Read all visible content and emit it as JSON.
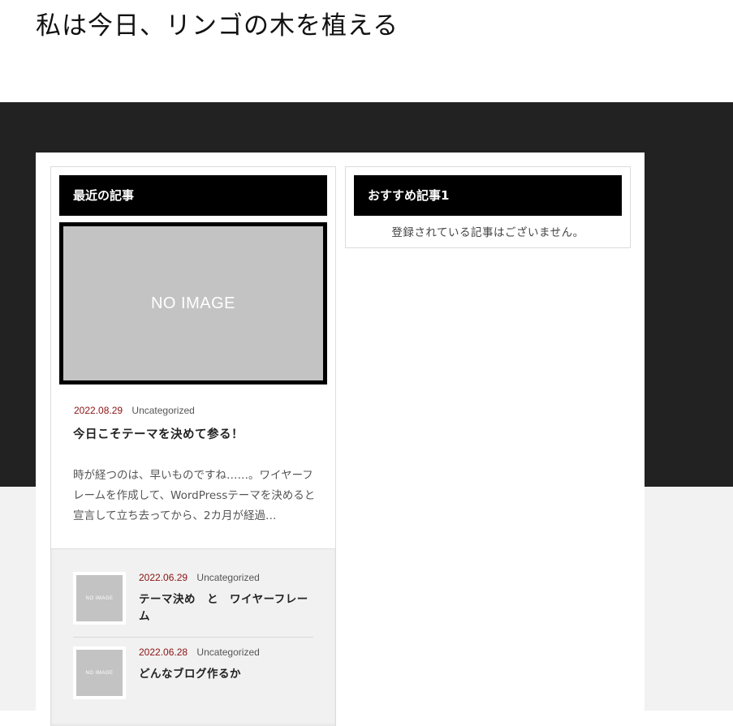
{
  "site": {
    "title": "私は今日、リンゴの木を植える"
  },
  "recent_widget": {
    "heading": "最近の記事",
    "featured": {
      "image_label": "NO IMAGE",
      "date": "2022.08.29",
      "category": "Uncategorized",
      "title": "今日こそテーマを決めて参る！",
      "excerpt": "時が経つのは、早いものですね……。ワイヤーフレームを作成して、WordPressテーマを決めると宣言して立ち去ってから、2カ月が経過…"
    },
    "items": [
      {
        "image_label": "NO IMAGE",
        "date": "2022.06.29",
        "category": "Uncategorized",
        "title": "テーマ決め　と　ワイヤーフレーム"
      },
      {
        "image_label": "NO IMAGE",
        "date": "2022.06.28",
        "category": "Uncategorized",
        "title": "どんなブログ作るか"
      }
    ]
  },
  "recommend_widget": {
    "heading": "おすすめ記事1",
    "empty_message": "登録されている記事はございません。"
  },
  "colors": {
    "hero_band": "#222222",
    "lower_band": "#f2f2f2",
    "widget_head": "#000000",
    "date_accent": "#8b1212",
    "placeholder": "#c3c3c3"
  }
}
